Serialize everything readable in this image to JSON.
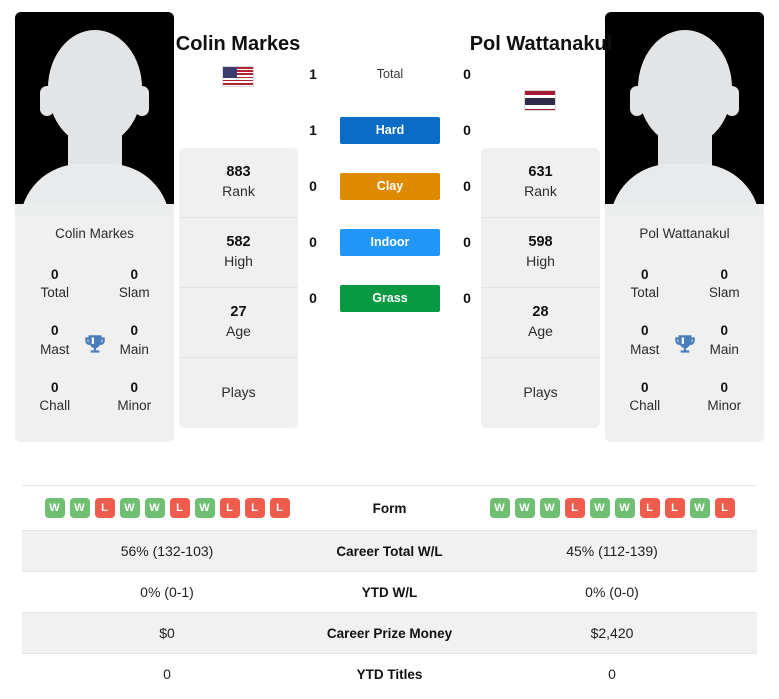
{
  "players": {
    "left": {
      "name": "Colin Markes",
      "card_name": "Colin Markes",
      "flag": "us-flag-icon",
      "rank": "883",
      "rank_label": "Rank",
      "high": "582",
      "high_label": "High",
      "age": "27",
      "age_label": "Age",
      "plays_label": "Plays",
      "plays_value": "",
      "titles": [
        {
          "num": "0",
          "label": "Total"
        },
        {
          "num": "0",
          "label": "Slam"
        },
        {
          "num": "0",
          "label": "Mast"
        },
        {
          "num": "0",
          "label": "Main"
        },
        {
          "num": "0",
          "label": "Chall"
        },
        {
          "num": "0",
          "label": "Minor"
        }
      ],
      "form": [
        "W",
        "W",
        "L",
        "W",
        "W",
        "L",
        "W",
        "L",
        "L",
        "L"
      ],
      "career_wl": "56% (132-103)",
      "ytd_wl": "0% (0-1)",
      "career_prize_money": "$0",
      "ytd_titles": "0"
    },
    "right": {
      "name": "Pol Wattanakul",
      "card_name": "Pol Wattanakul",
      "flag": "thailand-flag-icon",
      "rank": "631",
      "rank_label": "Rank",
      "high": "598",
      "high_label": "High",
      "age": "28",
      "age_label": "Age",
      "plays_label": "Plays",
      "plays_value": "",
      "titles": [
        {
          "num": "0",
          "label": "Total"
        },
        {
          "num": "0",
          "label": "Slam"
        },
        {
          "num": "0",
          "label": "Mast"
        },
        {
          "num": "0",
          "label": "Main"
        },
        {
          "num": "0",
          "label": "Chall"
        },
        {
          "num": "0",
          "label": "Minor"
        }
      ],
      "form": [
        "W",
        "W",
        "W",
        "L",
        "W",
        "W",
        "L",
        "L",
        "W",
        "L"
      ],
      "career_wl": "45% (112-139)",
      "ytd_wl": "0% (0-0)",
      "career_prize_money": "$2,420",
      "ytd_titles": "0"
    }
  },
  "head_to_head": {
    "total": {
      "label": "Total",
      "left": "1",
      "right": "0"
    },
    "surfaces": [
      {
        "label": "Hard",
        "left": "1",
        "right": "0",
        "color": "#0a6cc4"
      },
      {
        "label": "Clay",
        "left": "0",
        "right": "0",
        "color": "#e08a00"
      },
      {
        "label": "Indoor",
        "left": "0",
        "right": "0",
        "color": "#2196f9"
      },
      {
        "label": "Grass",
        "left": "0",
        "right": "0",
        "color": "#089a42"
      }
    ]
  },
  "compare_rows": {
    "form": "Form",
    "career_total_wl": "Career Total W/L",
    "ytd_wl": "YTD W/L",
    "career_prize_money": "Career Prize Money",
    "ytd_titles": "YTD Titles"
  },
  "colors": {
    "win_badge": "#6fbf73",
    "loss_badge": "#ef5b4c",
    "card_bg": "#f0f0f0",
    "trophy": "#4a7ebb"
  }
}
